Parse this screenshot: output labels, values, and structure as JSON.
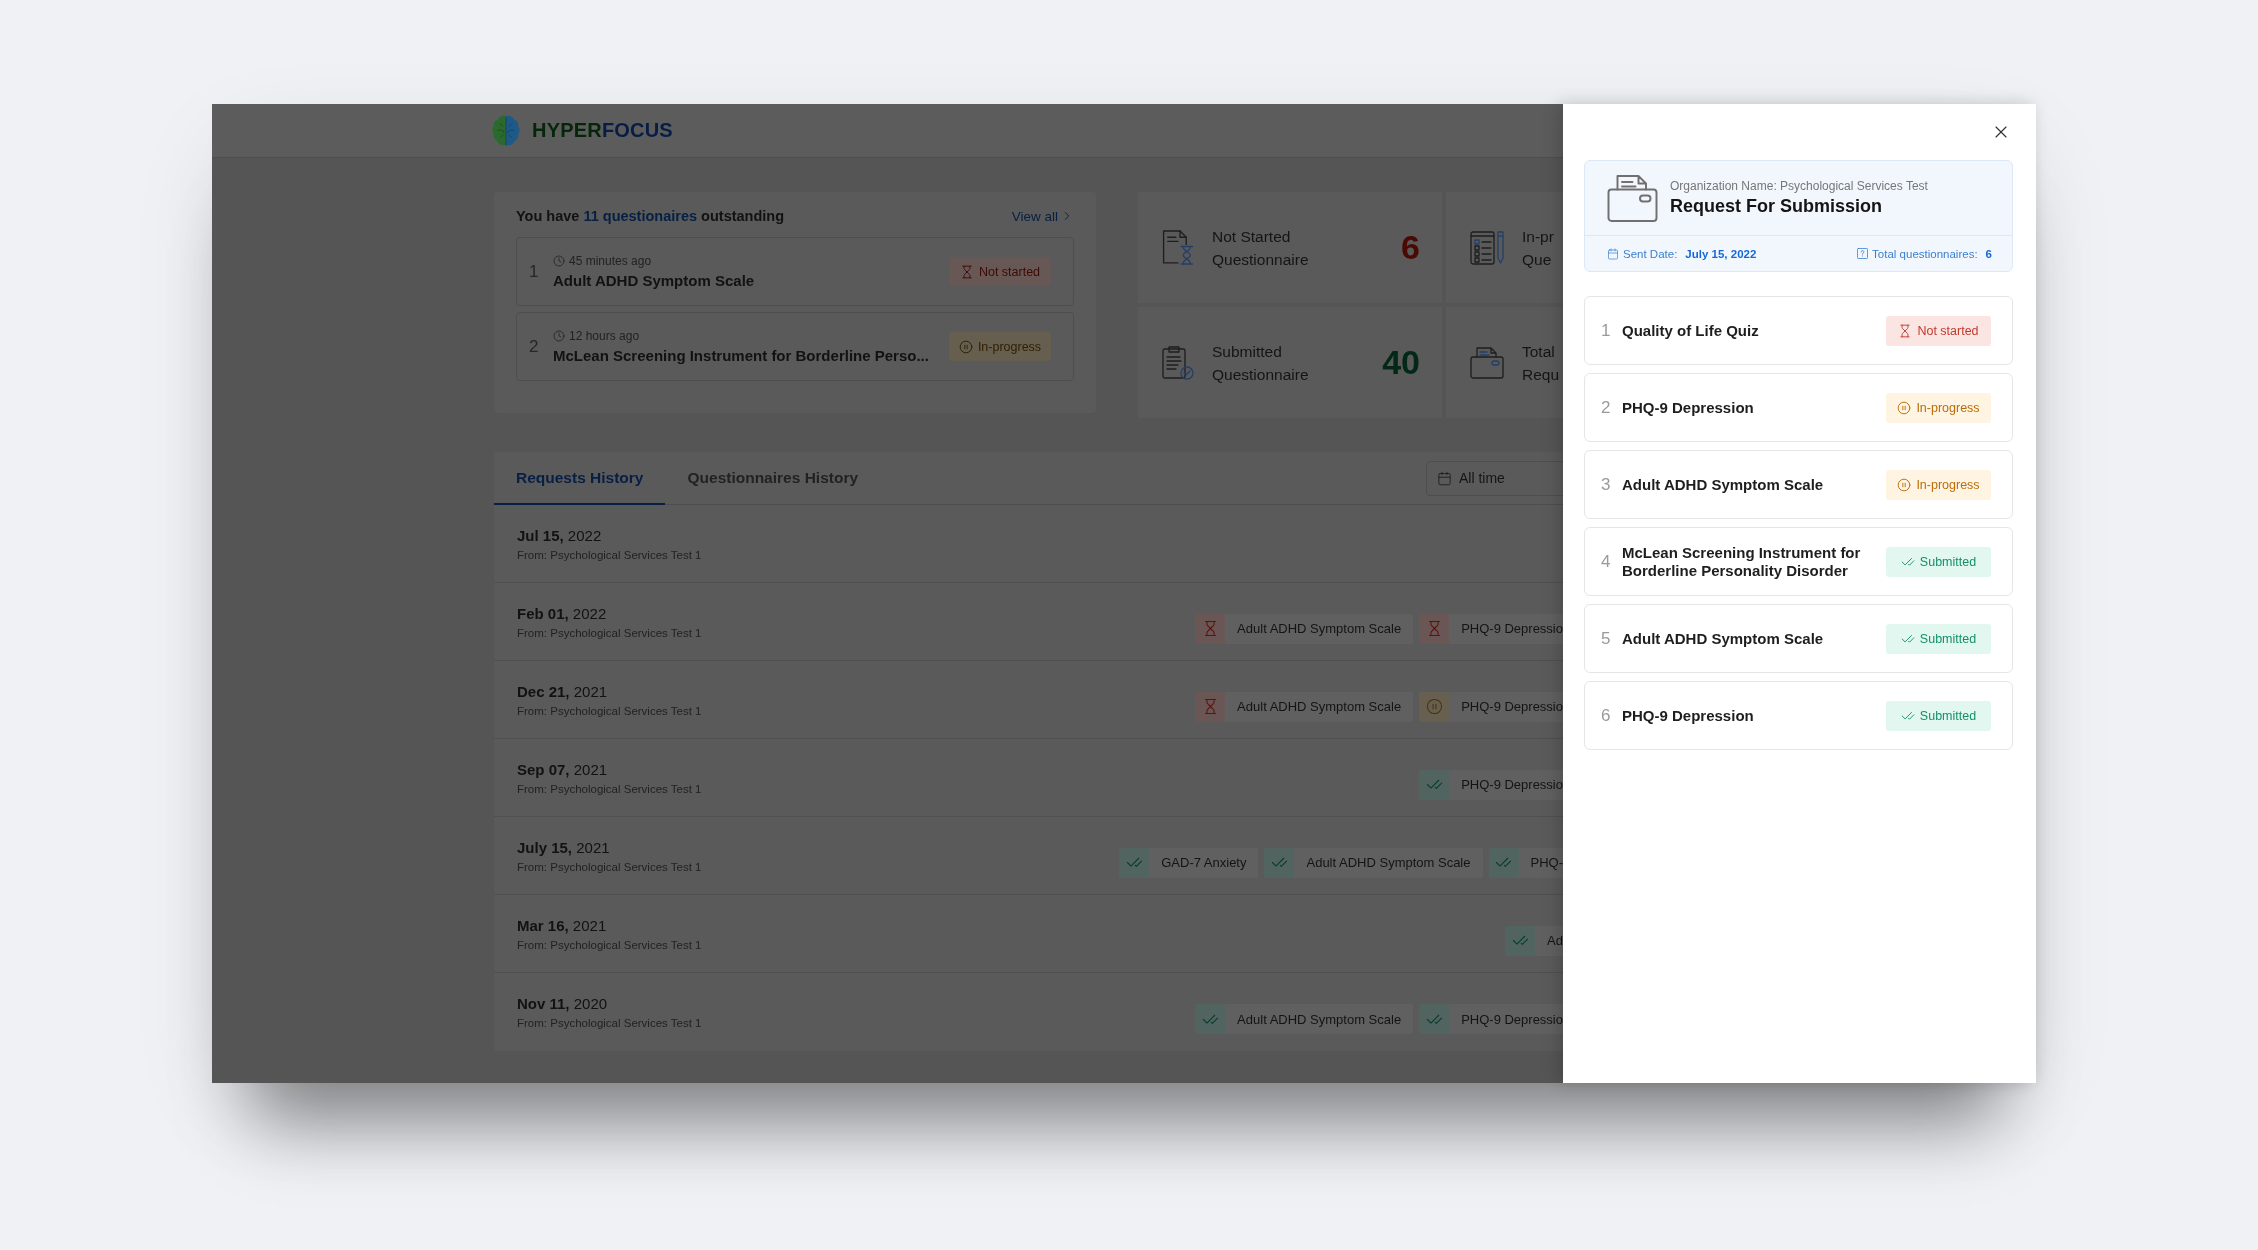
{
  "app": {
    "logo_text": [
      "HYPER",
      "FOCUS"
    ]
  },
  "outstanding": {
    "heading": {
      "before": "You have",
      "link": "11 questionaires",
      "after": "outstanding"
    },
    "view_all": "View all",
    "items": [
      {
        "number": "1",
        "time": "45 minutes ago",
        "title": "Adult ADHD Symptom Scale",
        "kind": "not_started",
        "badge": "Not started"
      },
      {
        "number": "2",
        "time": "12 hours ago",
        "title": "McLean Screening Instrument for Borderline Perso...",
        "kind": "in_progress",
        "badge": "In-progress"
      }
    ]
  },
  "stats": [
    {
      "kind": "not_started",
      "label_lines": [
        "Not Started",
        "Questionnaire"
      ],
      "value": "6"
    },
    {
      "kind": "in_progress",
      "label_lines": [
        "In-pr",
        "Que"
      ]
    },
    {
      "kind": "submitted",
      "label_lines": [
        "Submitted",
        "Questionnaire"
      ],
      "value": "40"
    },
    {
      "kind": "requests",
      "label_lines": [
        "Total",
        "Requ"
      ]
    }
  ],
  "history": {
    "tabs": [
      {
        "label": "Requests History",
        "selected": true
      },
      {
        "label": "Questionnaires History",
        "selected": false
      }
    ],
    "filter": {
      "value": "All time"
    },
    "rows": [
      {
        "date": "**Jul 15,** 2022",
        "from": "From: Psychological Services Test 1"
      },
      {
        "date": "**Feb 01,** 2022",
        "from": "From: Psychological Services Test 1",
        "chips": [
          {
            "name": "Adult ADHD Symptom Scale",
            "kind": "not_started"
          },
          {
            "name": "PHQ-9 Depressio",
            "kind": "not_started"
          }
        ]
      },
      {
        "date": "**Dec 21,** 2021",
        "from": "From: Psychological Services Test 1",
        "chips": [
          {
            "name": "Adult ADHD Symptom Scale",
            "kind": "not_started"
          },
          {
            "name": "PHQ-9 Depressio",
            "kind": "in_progress"
          }
        ]
      },
      {
        "date": "**Sep 07,** 2021",
        "from": "From: Psychological Services Test 1",
        "chips": [
          {
            "name": "PHQ-9 Depressio",
            "kind": "submitted"
          }
        ]
      },
      {
        "date": "**July 15,** 2021",
        "from": "From: Psychological Services Test 1",
        "chips": [
          {
            "name": "GAD-7 Anxiety",
            "kind": "submitted"
          },
          {
            "name": "Adult ADHD Symptom Scale",
            "kind": "submitted"
          },
          {
            "name": "PHQ-",
            "kind": "submitted"
          }
        ]
      },
      {
        "date": "**Mar 16,** 2021",
        "from": "From: Psychological Services Test 1",
        "chips": [
          {
            "name": "Ad",
            "kind": "submitted"
          }
        ]
      },
      {
        "date": "**Nov 11,** 2020",
        "from": "From: Psychological Services Test 1",
        "chips": [
          {
            "name": "Adult ADHD Symptom Scale",
            "kind": "submitted"
          },
          {
            "name": "PHQ-9 Depressio",
            "kind": "submitted"
          }
        ]
      }
    ]
  },
  "drawer": {
    "organization": "Organization Name: Psychological Services Test",
    "title": "Request For Submission",
    "sent_date_label": "Sent Date:",
    "sent_date": "July 15, 2022",
    "total_label": "Total questionnaires:",
    "total": "6",
    "items": [
      {
        "number": "1",
        "title": "Quality of Life Quiz",
        "kind": "not_started",
        "badge": "Not started"
      },
      {
        "number": "2",
        "title": "PHQ-9 Depression",
        "kind": "in_progress",
        "badge": "In-progress"
      },
      {
        "number": "3",
        "title": "Adult ADHD Symptom Scale",
        "kind": "in_progress",
        "badge": "In-progress"
      },
      {
        "number": "4",
        "title": "McLean Screening Instrument for Borderline Personality Disorder",
        "kind": "submitted",
        "badge": "Submitted"
      },
      {
        "number": "5",
        "title": "Adult ADHD Symptom Scale",
        "kind": "submitted",
        "badge": "Submitted"
      },
      {
        "number": "6",
        "title": "PHQ-9 Depression",
        "kind": "submitted",
        "badge": "Submitted"
      }
    ]
  }
}
